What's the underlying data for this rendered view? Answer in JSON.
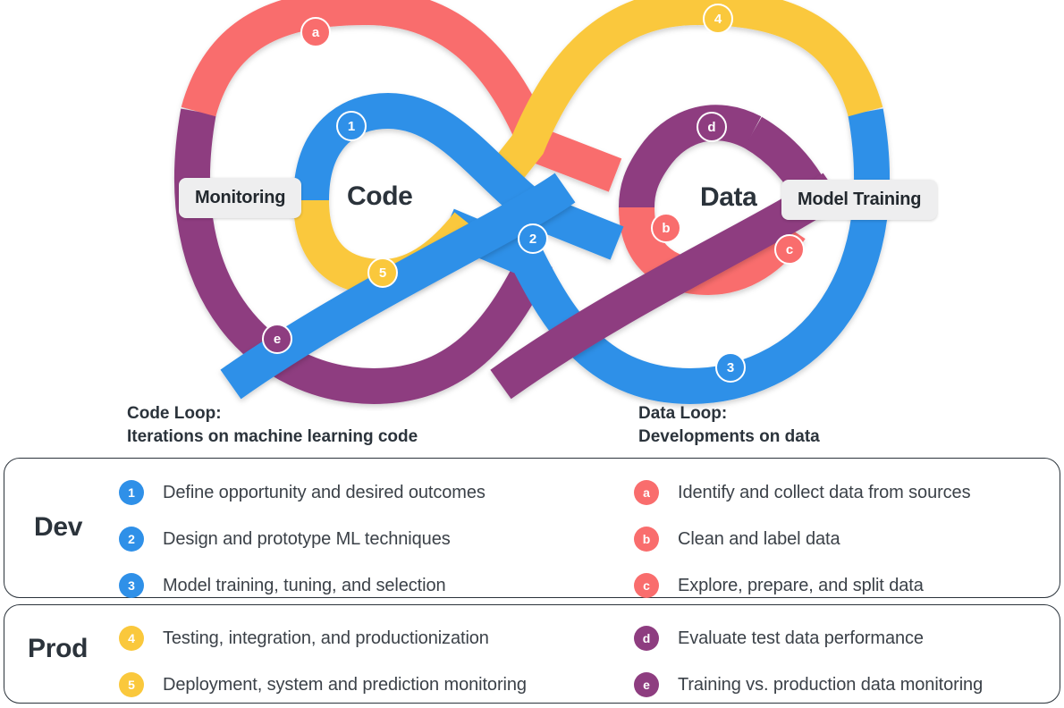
{
  "colors": {
    "blue": "#2f90e8",
    "red": "#f96d6d",
    "yellow": "#fac83c",
    "purple": "#8e3d80",
    "ink": "#2b333b"
  },
  "diagram": {
    "center_labels": {
      "left": "Code",
      "right": "Data"
    },
    "pills": {
      "left": "Monitoring",
      "right": "Model Training"
    },
    "markers": [
      {
        "id": "a",
        "label": "a",
        "color": "red"
      },
      {
        "id": "1",
        "label": "1",
        "color": "blue"
      },
      {
        "id": "2",
        "label": "2",
        "color": "blue"
      },
      {
        "id": "3",
        "label": "3",
        "color": "blue"
      },
      {
        "id": "4",
        "label": "4",
        "color": "yellow"
      },
      {
        "id": "5",
        "label": "5",
        "color": "yellow"
      },
      {
        "id": "b",
        "label": "b",
        "color": "red"
      },
      {
        "id": "c",
        "label": "c",
        "color": "red"
      },
      {
        "id": "d",
        "label": "d",
        "color": "purple"
      },
      {
        "id": "e",
        "label": "e",
        "color": "purple"
      }
    ]
  },
  "captions": {
    "code": {
      "title": "Code Loop:",
      "subtitle": "Iterations on machine learning code"
    },
    "data": {
      "title": "Data Loop:",
      "subtitle": "Developments on data"
    }
  },
  "legend": {
    "dev": {
      "label": "Dev",
      "left": [
        {
          "badge": "1",
          "color": "#2f90e8",
          "text": "Define opportunity and desired outcomes"
        },
        {
          "badge": "2",
          "color": "#2f90e8",
          "text": "Design and prototype ML techniques"
        },
        {
          "badge": "3",
          "color": "#2f90e8",
          "text": "Model training, tuning, and selection"
        }
      ],
      "right": [
        {
          "badge": "a",
          "color": "#f96d6d",
          "text": "Identify and collect data from sources"
        },
        {
          "badge": "b",
          "color": "#f96d6d",
          "text": "Clean and label data"
        },
        {
          "badge": "c",
          "color": "#f96d6d",
          "text": "Explore, prepare, and split data"
        }
      ]
    },
    "prod": {
      "label": "Prod",
      "left": [
        {
          "badge": "4",
          "color": "#fac83c",
          "text": "Testing, integration, and productionization"
        },
        {
          "badge": "5",
          "color": "#fac83c",
          "text": "Deployment, system and prediction monitoring"
        }
      ],
      "right": [
        {
          "badge": "d",
          "color": "#8e3d80",
          "text": "Evaluate test data performance"
        },
        {
          "badge": "e",
          "color": "#8e3d80",
          "text": "Training vs. production data monitoring"
        }
      ]
    }
  }
}
